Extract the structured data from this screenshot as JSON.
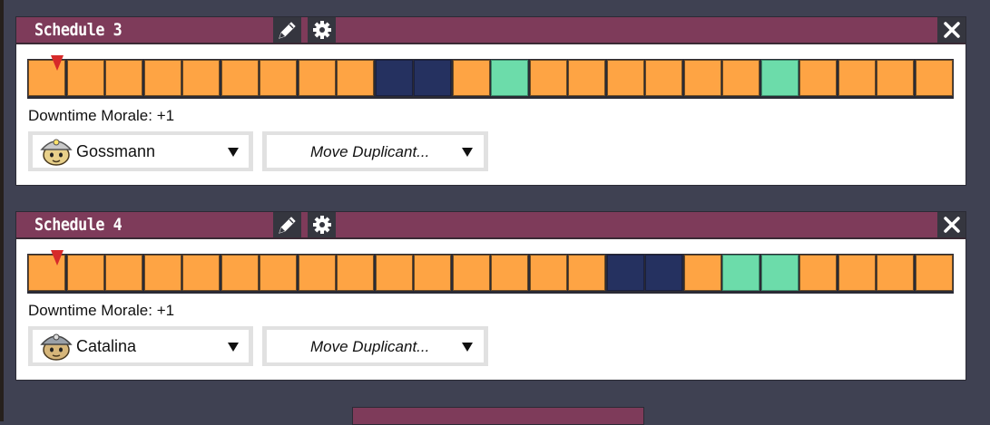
{
  "schedules": [
    {
      "title": "Schedule 3",
      "morale": "Downtime Morale: +1",
      "duplicant": "Gossmann",
      "move_label": "Move Duplicant...",
      "blocks": [
        "work",
        "work",
        "work",
        "work",
        "work",
        "work",
        "work",
        "work",
        "work",
        "sleep",
        "sleep",
        "work",
        "recreation",
        "work",
        "work",
        "work",
        "work",
        "work",
        "work",
        "recreation",
        "work",
        "work",
        "work",
        "work"
      ]
    },
    {
      "title": "Schedule 4",
      "morale": "Downtime Morale: +1",
      "duplicant": "Catalina",
      "move_label": "Move Duplicant...",
      "blocks": [
        "work",
        "work",
        "work",
        "work",
        "work",
        "work",
        "work",
        "work",
        "work",
        "work",
        "work",
        "work",
        "work",
        "work",
        "work",
        "sleep",
        "sleep",
        "work",
        "recreation",
        "recreation",
        "work",
        "work",
        "work",
        "work"
      ]
    }
  ],
  "icons": {
    "rename": "pencil-icon",
    "options": "gear-icon",
    "close": "close-icon",
    "dropdown": "triangle-down-icon",
    "time_marker": "triangle-down-icon"
  },
  "colors": {
    "header": "#7e3b5a",
    "work": "#fea444",
    "sleep": "#253160",
    "recreation": "#6cdcaa",
    "marker": "#d62a2a",
    "background": "#3f4152"
  }
}
